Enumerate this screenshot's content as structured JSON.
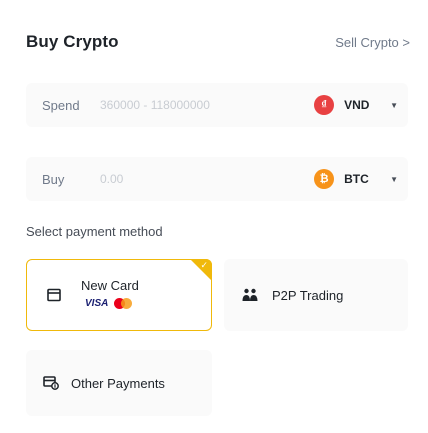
{
  "header": {
    "title": "Buy Crypto",
    "sell_link": "Sell Crypto >"
  },
  "spend": {
    "label": "Spend",
    "placeholder": "360000 - 118000000",
    "currency": {
      "code": "VND",
      "icon": "vnd-coin-icon",
      "icon_glyph": "₫",
      "color": "#e84142"
    }
  },
  "buy": {
    "label": "Buy",
    "placeholder": "0.00",
    "currency": {
      "code": "BTC",
      "icon": "btc-coin-icon",
      "icon_glyph": "₿",
      "color": "#f7931a"
    }
  },
  "payment": {
    "section_label": "Select payment method",
    "methods": [
      {
        "label": "New Card",
        "selected": true,
        "brands": [
          "VISA",
          "mastercard"
        ]
      },
      {
        "label": "P2P Trading",
        "selected": false
      },
      {
        "label": "Other Payments",
        "selected": false
      }
    ]
  },
  "colors": {
    "accent": "#f0b90b",
    "text": "#1e2329",
    "muted": "#707a8a"
  }
}
